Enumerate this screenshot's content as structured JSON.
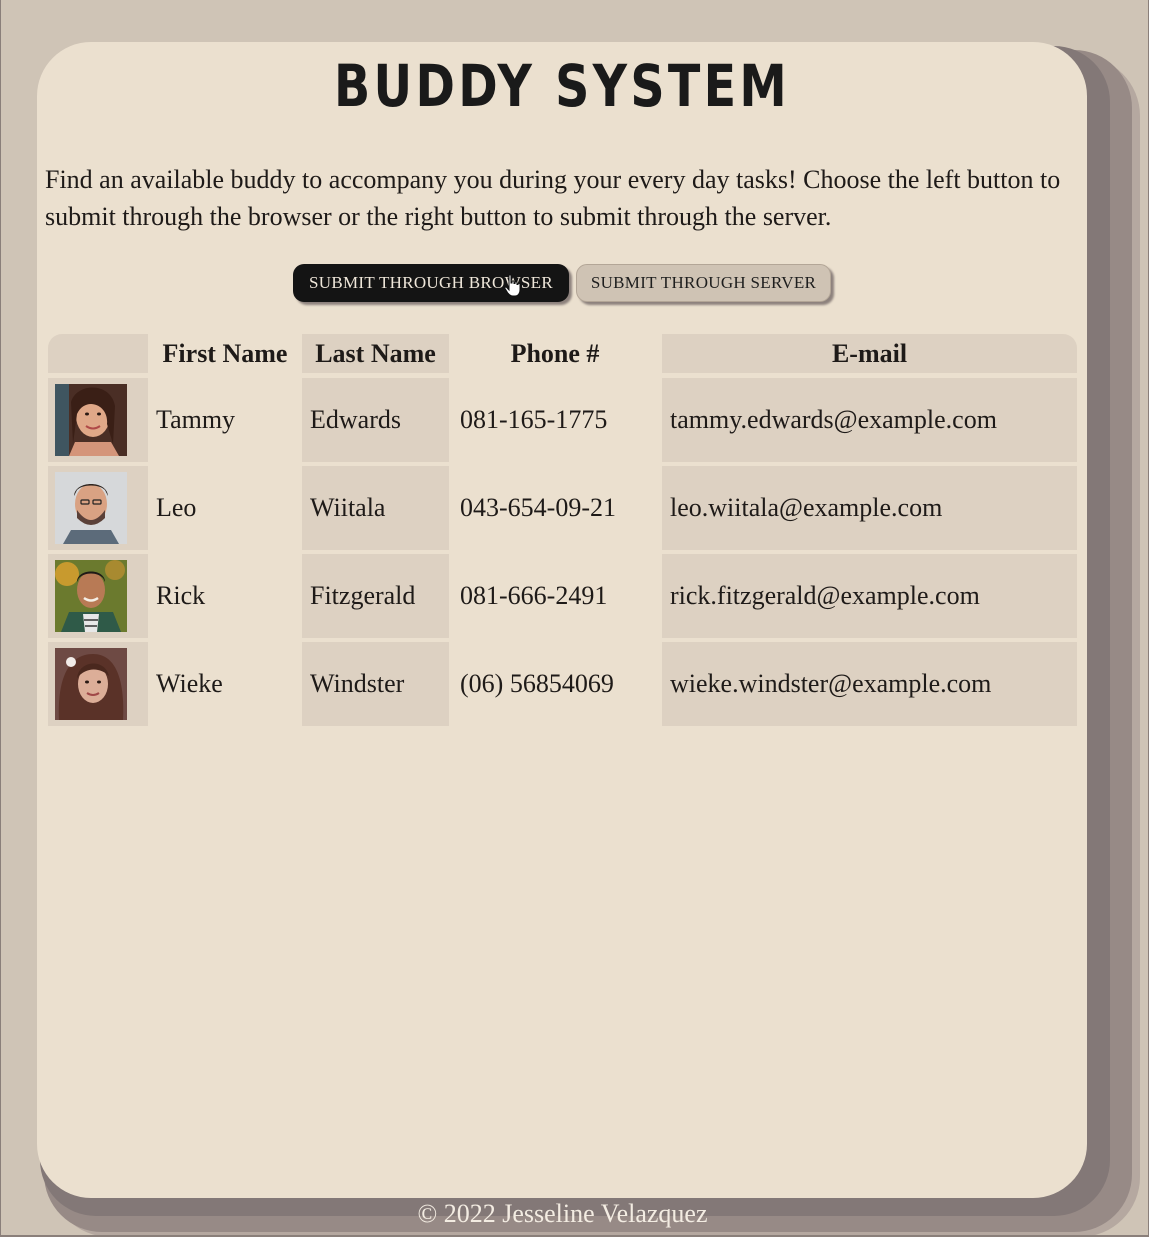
{
  "page": {
    "title": "BUDDY SYSTEM",
    "intro": "Find an available buddy to accompany you during your every day tasks! Choose the left button to submit through the browser or the right button to submit through the server.",
    "footer": "© 2022 Jesseline Velazquez"
  },
  "buttons": {
    "browser_label": "Submit through browser",
    "server_label": "Submit through server"
  },
  "table": {
    "headers": {
      "photo": "",
      "first": "First Name",
      "last": "Last Name",
      "phone": "Phone #",
      "email": "E-mail"
    },
    "rows": [
      {
        "first": "Tammy",
        "last": "Edwards",
        "phone": "081-165-1775",
        "email": "tammy.edwards@example.com"
      },
      {
        "first": "Leo",
        "last": "Wiitala",
        "phone": "043-654-09-21",
        "email": "leo.wiitala@example.com"
      },
      {
        "first": "Rick",
        "last": "Fitzgerald",
        "phone": "081-666-2491",
        "email": "rick.fitzgerald@example.com"
      },
      {
        "first": "Wieke",
        "last": "Windster",
        "phone": "(06) 56854069",
        "email": "wieke.windster@example.com"
      }
    ]
  },
  "colors": {
    "page_bg": "#cfc4b6",
    "card_bg": "#ebe0cf",
    "shaded_cell": "#ddd1c2",
    "primary_button": "#141414"
  }
}
